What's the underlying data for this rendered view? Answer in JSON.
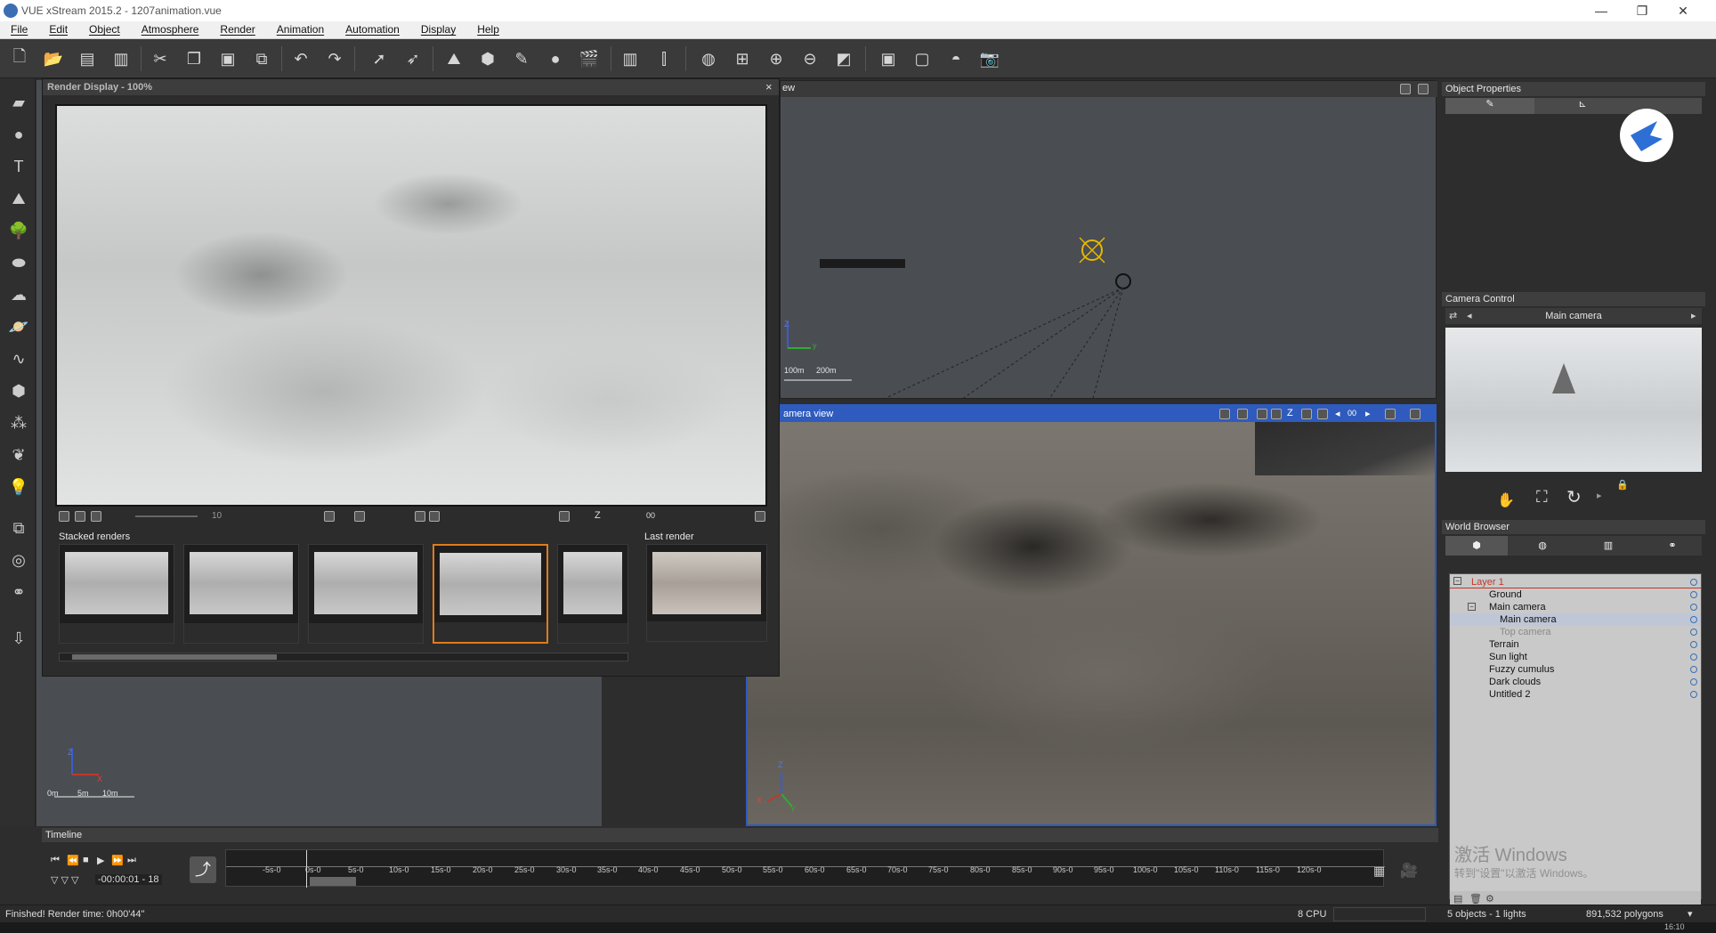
{
  "window": {
    "title": "VUE xStream 2015.2 - 1207animation.vue",
    "controls": [
      "—",
      "❐",
      "✕"
    ]
  },
  "menubar": {
    "items": [
      "File",
      "Edit",
      "Object",
      "Atmosphere",
      "Render",
      "Animation",
      "Automation",
      "Display",
      "Help"
    ]
  },
  "render_display": {
    "title": "Render Display - 100%",
    "close": "×",
    "stacked_label": "Stacked renders",
    "last_label": "Last render",
    "slider_value": "10",
    "controls_text": "00",
    "z_label": "Z"
  },
  "top_view": {
    "label": "ew",
    "axis_z": "Z",
    "axis_y": "y",
    "scale_1": "100m",
    "scale_2": "200m"
  },
  "camera_view": {
    "label": "amera view",
    "z_label": "Z",
    "counter": "00",
    "axis_z": "Z",
    "axis_x": "X",
    "axis_y": "Y"
  },
  "front_view": {
    "axis_z": "Z",
    "axis_x": "X",
    "scale_0": "0m",
    "scale_1": "5m",
    "scale_2": "10m"
  },
  "object_properties": {
    "title": "Object Properties"
  },
  "camera_control": {
    "title": "Camera Control",
    "camera_name": "Main camera"
  },
  "world_browser": {
    "title": "World Browser",
    "items": [
      {
        "label": "Layer 1",
        "color": "#c0392b"
      },
      {
        "label": "Ground",
        "color": "#222222"
      },
      {
        "label": "Main camera",
        "color": "#111111"
      },
      {
        "label": "Main camera",
        "color": "#111111"
      },
      {
        "label": "Top camera",
        "color": "#8a8a8a"
      },
      {
        "label": "Terrain",
        "color": "#111111"
      },
      {
        "label": "Sun light",
        "color": "#111111"
      },
      {
        "label": "Fuzzy cumulus",
        "color": "#333333"
      },
      {
        "label": "Dark clouds",
        "color": "#333333"
      },
      {
        "label": "Untitled 2",
        "color": "#111111"
      }
    ]
  },
  "timeline": {
    "title": "Timeline",
    "time": "-00:00:01 - 18",
    "ticks": [
      "-5s-0",
      "0s-0",
      "5s-0",
      "10s-0",
      "15s-0",
      "20s-0",
      "25s-0",
      "30s-0",
      "35s-0",
      "40s-0",
      "45s-0",
      "50s-0",
      "55s-0",
      "60s-0",
      "65s-0",
      "70s-0",
      "75s-0",
      "80s-0",
      "85s-0",
      "90s-0",
      "95s-0",
      "100s-0",
      "105s-0",
      "110s-0",
      "115s-0",
      "120s-0"
    ]
  },
  "status": {
    "message": "Finished! Render time: 0h00'44\"",
    "cpu": "8 CPU",
    "objects": "5 objects - 1 lights",
    "polygons": "891,532 polygons"
  },
  "watermark": {
    "line1": "激活 Windows",
    "line2": "转到\"设置\"以激活 Windows。"
  },
  "taskbar": {
    "clock": "16:10"
  },
  "colors": {
    "accent": "#2e5bbd",
    "selected_thumb": "#e07b1a",
    "sun": "#e6b800"
  }
}
